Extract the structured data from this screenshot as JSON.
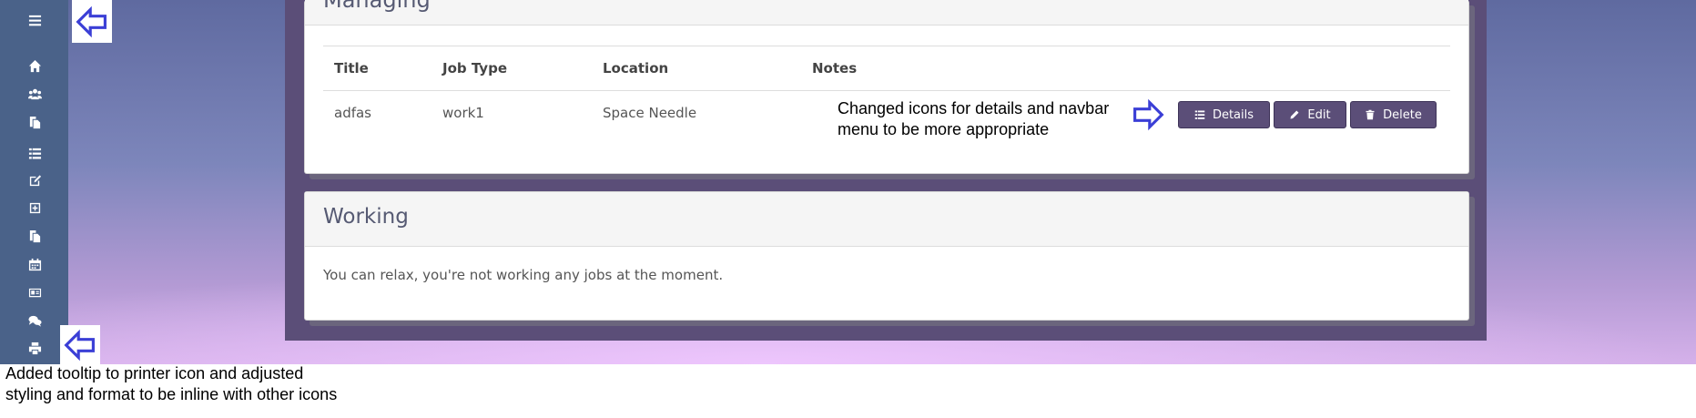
{
  "sidebar": {
    "icons": [
      "menu-icon",
      "home-icon",
      "users-icon",
      "copy-icon",
      "list-icon",
      "edit-icon",
      "plus-square-icon",
      "files-icon",
      "calendar-icon",
      "id-card-icon",
      "comments-icon",
      "printer-icon"
    ]
  },
  "managing": {
    "title": "Managing",
    "columns": [
      "Title",
      "Job Type",
      "Location",
      "Notes"
    ],
    "rows": [
      {
        "title": "adfas",
        "job_type": "work1",
        "location": "Space Needle",
        "notes": ""
      }
    ],
    "actions": {
      "details": "Details",
      "edit": "Edit",
      "delete": "Delete"
    }
  },
  "working": {
    "title": "Working",
    "message": "You can relax, you're not working any jobs at the moment."
  },
  "annotations": {
    "row_note_line1": "Changed icons for details and navbar",
    "row_note_line2": "menu to be more appropriate",
    "bottom_note_line1": "Added tooltip to printer icon and adjusted",
    "bottom_note_line2": "styling and format to be inline with other icons"
  },
  "colors": {
    "sidebar": "#4a6289",
    "frame": "#5b4e78",
    "button": "#5b4e78",
    "annotation_arrow": "#3b3fd6"
  }
}
